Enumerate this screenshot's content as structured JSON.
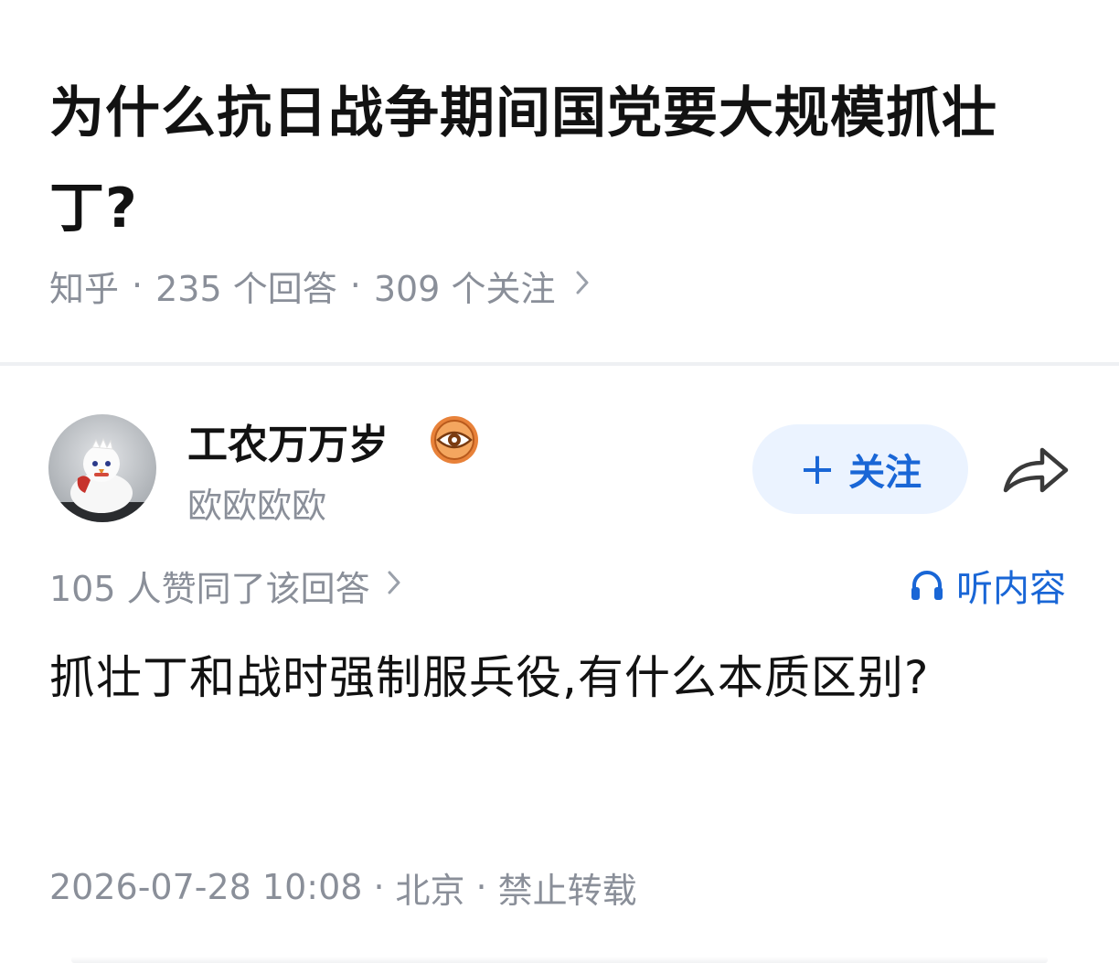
{
  "question": {
    "title": "为什么抗日战争期间国党要大规模抓壮丁?",
    "source": "知乎",
    "answer_count": "235 个回答",
    "follower_count": "309 个关注",
    "separator": "·",
    "chevron_icon": "chevron-right-icon"
  },
  "author": {
    "name": "工农万万岁",
    "bio": "欧欧欧欧",
    "avatar_icon": "avatar-image",
    "badge_icon": "eye-badge-icon",
    "badge_color": "#e8823a"
  },
  "follow_button": {
    "plus": "+",
    "label": "关注",
    "bg_color": "#ebf3ff",
    "text_color": "#1966d6"
  },
  "share": {
    "icon": "share-icon"
  },
  "answer": {
    "voteup_text": "105 人赞同了该回答",
    "listen_label": "听内容",
    "listen_icon": "headphones-icon",
    "content": "抓壮丁和战时强制服兵役,有什么本质区别?",
    "created_time": "2026-07-28 10:08",
    "location": "北京",
    "copyright": "禁止转载",
    "separator": "·"
  },
  "colors": {
    "accent": "#1966d6",
    "muted_text": "#8a8f99",
    "primary_text": "#121212",
    "divider": "#eef0f3"
  }
}
